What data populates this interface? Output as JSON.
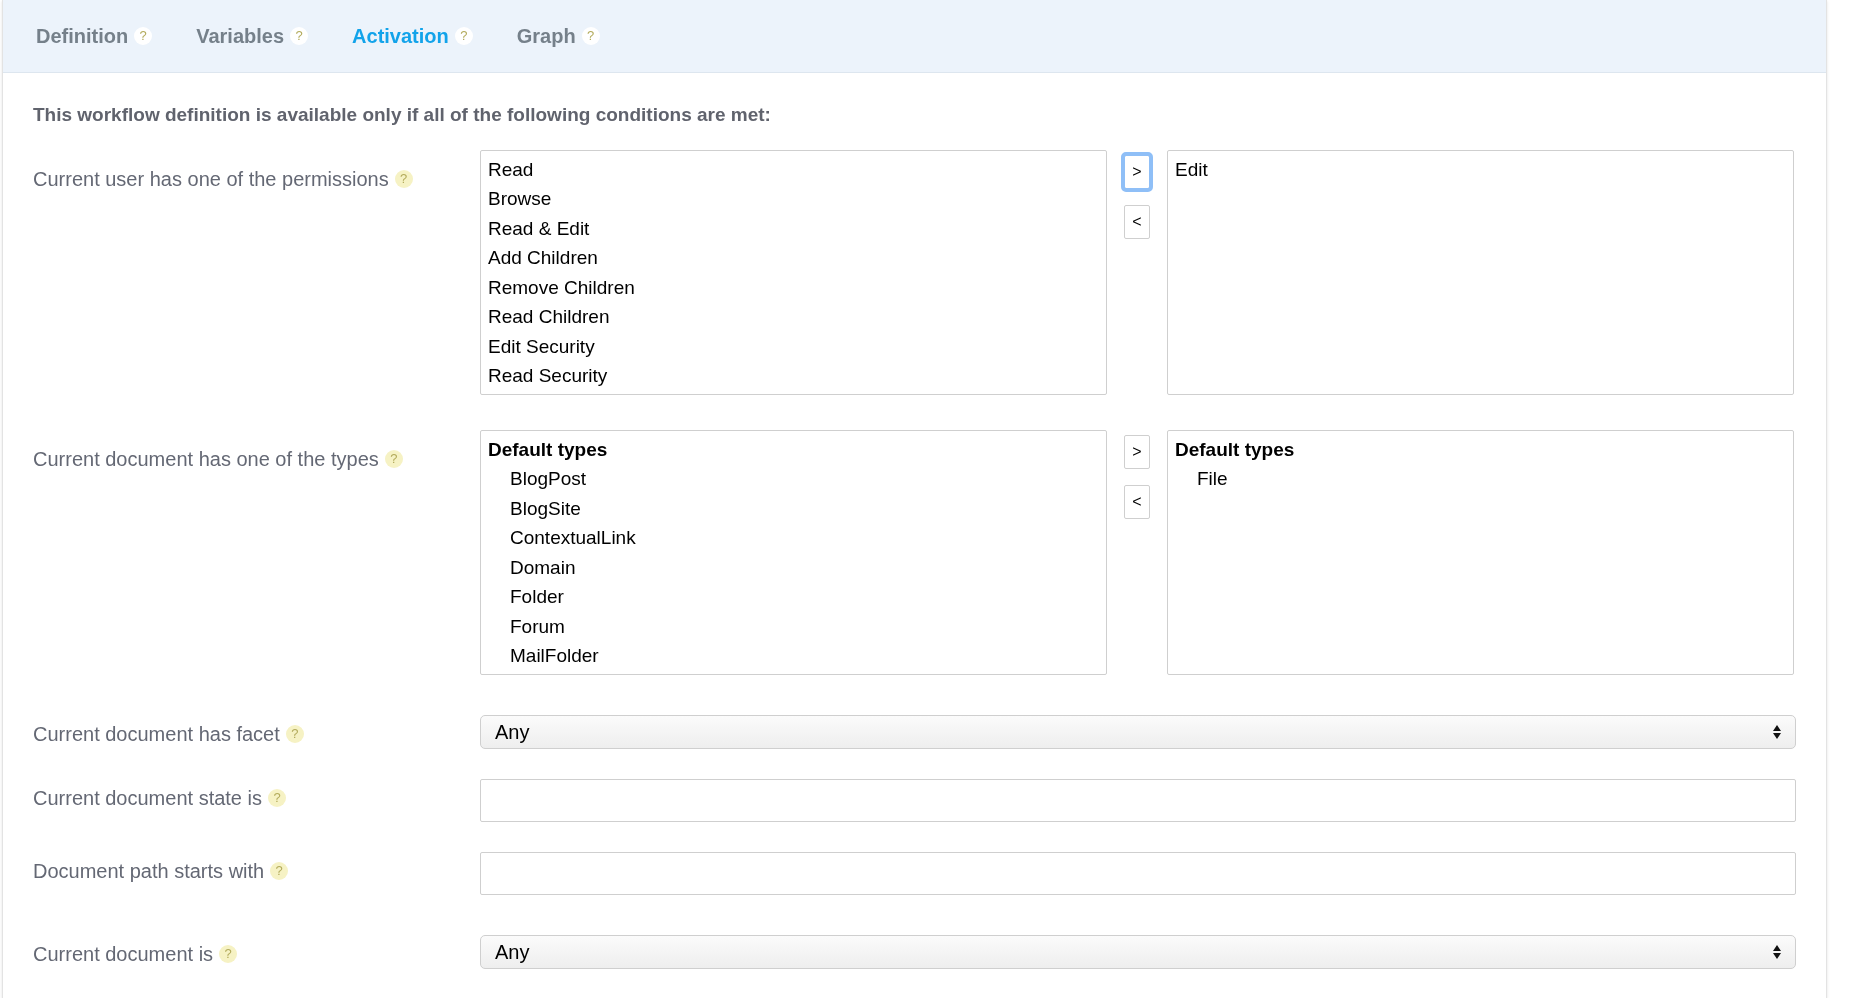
{
  "tabs": [
    {
      "label": "Definition",
      "help": "?",
      "selected": false
    },
    {
      "label": "Variables",
      "help": "?",
      "selected": false
    },
    {
      "label": "Activation",
      "help": "?",
      "selected": true
    },
    {
      "label": "Graph",
      "help": "?",
      "selected": false
    }
  ],
  "heading": "This workflow definition is available only if all of the following conditions are met:",
  "fields": [
    {
      "kind": "dual_list",
      "label": "Current user has one of the permissions",
      "help": "?",
      "available": [
        {
          "text": "Read"
        },
        {
          "text": "Browse"
        },
        {
          "text": "Read & Edit"
        },
        {
          "text": "Add Children"
        },
        {
          "text": "Remove Children"
        },
        {
          "text": "Read Children"
        },
        {
          "text": "Edit Security"
        },
        {
          "text": "Read Security"
        }
      ],
      "buttons": [
        {
          "label": ">",
          "focused": true
        },
        {
          "label": "<",
          "focused": false
        }
      ],
      "chosen": [
        {
          "text": "Edit"
        }
      ]
    },
    {
      "kind": "dual_list",
      "label": "Current document has one of the types",
      "help": "?",
      "available": [
        {
          "text": "Default types",
          "children": [
            {
              "text": "BlogPost"
            },
            {
              "text": "BlogSite"
            },
            {
              "text": "ContextualLink"
            },
            {
              "text": "Domain"
            },
            {
              "text": "Folder"
            },
            {
              "text": "Forum"
            },
            {
              "text": "MailFolder"
            }
          ]
        }
      ],
      "buttons": [
        {
          "label": ">",
          "focused": false
        },
        {
          "label": "<",
          "focused": false
        }
      ],
      "chosen": [
        {
          "text": "Default types",
          "children": [
            {
              "text": "File"
            }
          ]
        }
      ]
    },
    {
      "kind": "select",
      "label": "Current document has facet",
      "help": "?",
      "value": "Any"
    },
    {
      "kind": "text",
      "label": "Current document state is",
      "help": "?"
    },
    {
      "kind": "text",
      "label": "Document path starts with",
      "help": "?"
    },
    {
      "kind": "select",
      "label": "Current document is",
      "help": "?",
      "value": "Any"
    }
  ]
}
